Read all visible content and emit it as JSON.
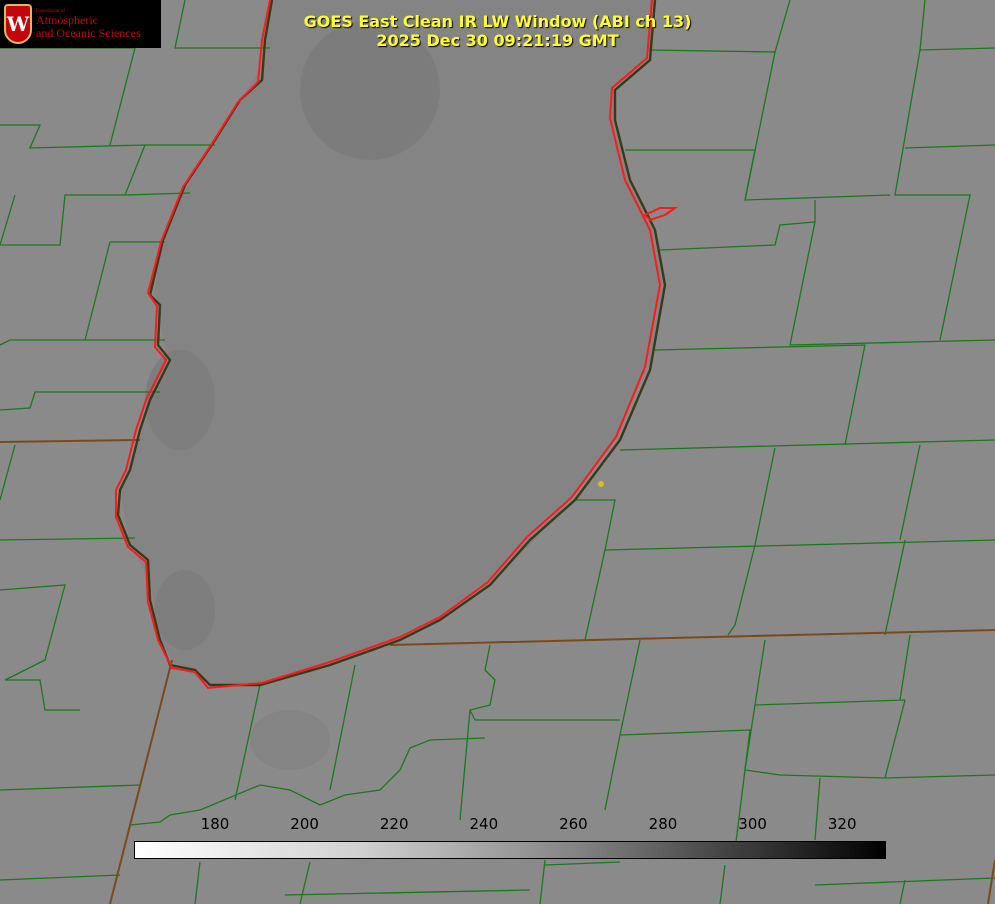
{
  "logo": {
    "crest_letter": "W",
    "department_line": "Department of",
    "line1": "Atmospheric",
    "line2": "and Oceanic Sciences"
  },
  "title": {
    "line1": "GOES East Clean IR LW Window (ABI ch 13)",
    "line2": "2025 Dec 30 09:21:19 GMT"
  },
  "colorbar": {
    "ticks": [
      "180",
      "200",
      "220",
      "240",
      "260",
      "280",
      "300",
      "320"
    ],
    "colors": {
      "low": "#ffffff",
      "high": "#000000"
    }
  },
  "colors": {
    "background": "#8a8a8a",
    "lake": "#7c7c7c",
    "county_lines": "#1a7a1a",
    "state_lines": "#7a4a1a",
    "lake_shore": "#ff1a1a",
    "title": "#ffff33",
    "marker": "#d4c21a"
  }
}
